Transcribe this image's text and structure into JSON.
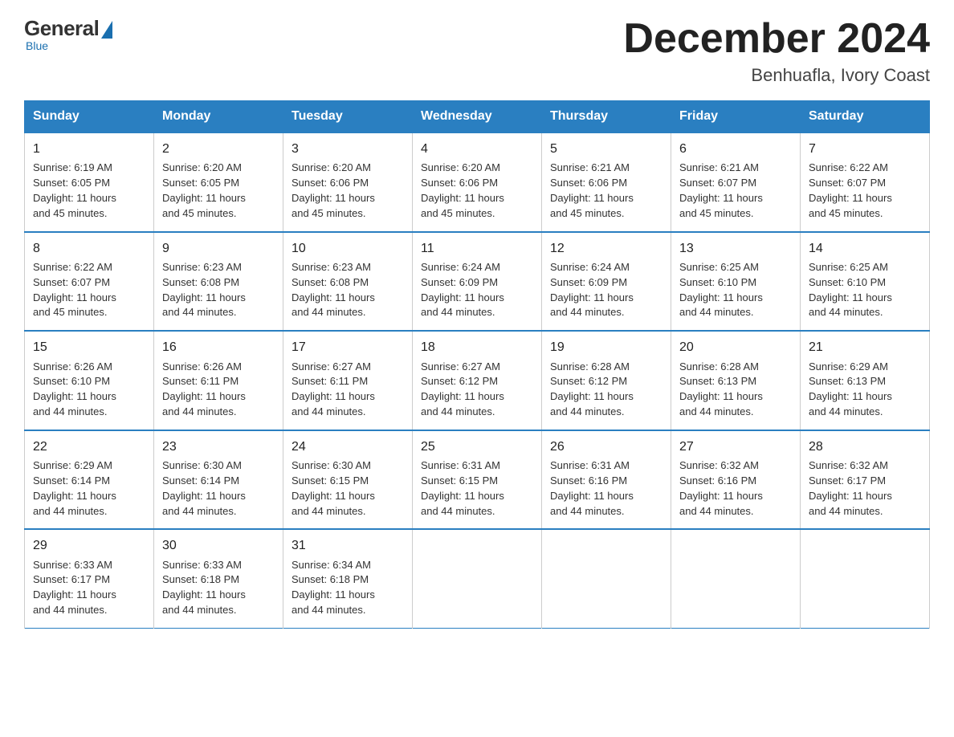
{
  "logo": {
    "general": "General",
    "blue": "Blue",
    "tagline": "Blue"
  },
  "title": "December 2024",
  "subtitle": "Benhuafla, Ivory Coast",
  "days_of_week": [
    "Sunday",
    "Monday",
    "Tuesday",
    "Wednesday",
    "Thursday",
    "Friday",
    "Saturday"
  ],
  "weeks": [
    [
      {
        "day": "1",
        "info": "Sunrise: 6:19 AM\nSunset: 6:05 PM\nDaylight: 11 hours\nand 45 minutes."
      },
      {
        "day": "2",
        "info": "Sunrise: 6:20 AM\nSunset: 6:05 PM\nDaylight: 11 hours\nand 45 minutes."
      },
      {
        "day": "3",
        "info": "Sunrise: 6:20 AM\nSunset: 6:06 PM\nDaylight: 11 hours\nand 45 minutes."
      },
      {
        "day": "4",
        "info": "Sunrise: 6:20 AM\nSunset: 6:06 PM\nDaylight: 11 hours\nand 45 minutes."
      },
      {
        "day": "5",
        "info": "Sunrise: 6:21 AM\nSunset: 6:06 PM\nDaylight: 11 hours\nand 45 minutes."
      },
      {
        "day": "6",
        "info": "Sunrise: 6:21 AM\nSunset: 6:07 PM\nDaylight: 11 hours\nand 45 minutes."
      },
      {
        "day": "7",
        "info": "Sunrise: 6:22 AM\nSunset: 6:07 PM\nDaylight: 11 hours\nand 45 minutes."
      }
    ],
    [
      {
        "day": "8",
        "info": "Sunrise: 6:22 AM\nSunset: 6:07 PM\nDaylight: 11 hours\nand 45 minutes."
      },
      {
        "day": "9",
        "info": "Sunrise: 6:23 AM\nSunset: 6:08 PM\nDaylight: 11 hours\nand 44 minutes."
      },
      {
        "day": "10",
        "info": "Sunrise: 6:23 AM\nSunset: 6:08 PM\nDaylight: 11 hours\nand 44 minutes."
      },
      {
        "day": "11",
        "info": "Sunrise: 6:24 AM\nSunset: 6:09 PM\nDaylight: 11 hours\nand 44 minutes."
      },
      {
        "day": "12",
        "info": "Sunrise: 6:24 AM\nSunset: 6:09 PM\nDaylight: 11 hours\nand 44 minutes."
      },
      {
        "day": "13",
        "info": "Sunrise: 6:25 AM\nSunset: 6:10 PM\nDaylight: 11 hours\nand 44 minutes."
      },
      {
        "day": "14",
        "info": "Sunrise: 6:25 AM\nSunset: 6:10 PM\nDaylight: 11 hours\nand 44 minutes."
      }
    ],
    [
      {
        "day": "15",
        "info": "Sunrise: 6:26 AM\nSunset: 6:10 PM\nDaylight: 11 hours\nand 44 minutes."
      },
      {
        "day": "16",
        "info": "Sunrise: 6:26 AM\nSunset: 6:11 PM\nDaylight: 11 hours\nand 44 minutes."
      },
      {
        "day": "17",
        "info": "Sunrise: 6:27 AM\nSunset: 6:11 PM\nDaylight: 11 hours\nand 44 minutes."
      },
      {
        "day": "18",
        "info": "Sunrise: 6:27 AM\nSunset: 6:12 PM\nDaylight: 11 hours\nand 44 minutes."
      },
      {
        "day": "19",
        "info": "Sunrise: 6:28 AM\nSunset: 6:12 PM\nDaylight: 11 hours\nand 44 minutes."
      },
      {
        "day": "20",
        "info": "Sunrise: 6:28 AM\nSunset: 6:13 PM\nDaylight: 11 hours\nand 44 minutes."
      },
      {
        "day": "21",
        "info": "Sunrise: 6:29 AM\nSunset: 6:13 PM\nDaylight: 11 hours\nand 44 minutes."
      }
    ],
    [
      {
        "day": "22",
        "info": "Sunrise: 6:29 AM\nSunset: 6:14 PM\nDaylight: 11 hours\nand 44 minutes."
      },
      {
        "day": "23",
        "info": "Sunrise: 6:30 AM\nSunset: 6:14 PM\nDaylight: 11 hours\nand 44 minutes."
      },
      {
        "day": "24",
        "info": "Sunrise: 6:30 AM\nSunset: 6:15 PM\nDaylight: 11 hours\nand 44 minutes."
      },
      {
        "day": "25",
        "info": "Sunrise: 6:31 AM\nSunset: 6:15 PM\nDaylight: 11 hours\nand 44 minutes."
      },
      {
        "day": "26",
        "info": "Sunrise: 6:31 AM\nSunset: 6:16 PM\nDaylight: 11 hours\nand 44 minutes."
      },
      {
        "day": "27",
        "info": "Sunrise: 6:32 AM\nSunset: 6:16 PM\nDaylight: 11 hours\nand 44 minutes."
      },
      {
        "day": "28",
        "info": "Sunrise: 6:32 AM\nSunset: 6:17 PM\nDaylight: 11 hours\nand 44 minutes."
      }
    ],
    [
      {
        "day": "29",
        "info": "Sunrise: 6:33 AM\nSunset: 6:17 PM\nDaylight: 11 hours\nand 44 minutes."
      },
      {
        "day": "30",
        "info": "Sunrise: 6:33 AM\nSunset: 6:18 PM\nDaylight: 11 hours\nand 44 minutes."
      },
      {
        "day": "31",
        "info": "Sunrise: 6:34 AM\nSunset: 6:18 PM\nDaylight: 11 hours\nand 44 minutes."
      },
      null,
      null,
      null,
      null
    ]
  ]
}
